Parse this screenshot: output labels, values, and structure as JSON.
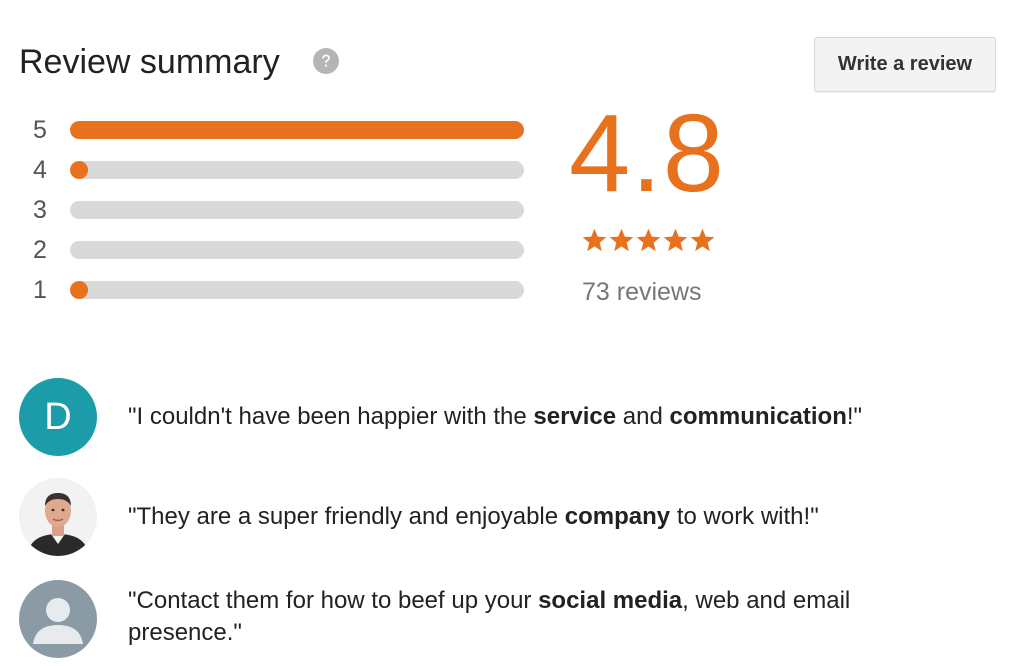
{
  "header": {
    "title": "Review summary",
    "help_icon": "question-circle-icon",
    "write_review_label": "Write a review"
  },
  "ratings": [
    {
      "label": "5",
      "fraction": 1.0
    },
    {
      "label": "4",
      "fraction": 0.04
    },
    {
      "label": "3",
      "fraction": 0.0
    },
    {
      "label": "2",
      "fraction": 0.0
    },
    {
      "label": "1",
      "fraction": 0.04
    }
  ],
  "summary": {
    "score": "4.8",
    "stars": 5,
    "review_count": "73 reviews"
  },
  "colors": {
    "accent": "#e8711e",
    "track": "#d9d9d9",
    "avatar_teal": "#1c9ca8",
    "avatar_gray": "#8a9ba6"
  },
  "reviews": [
    {
      "avatar": "letter-avatar",
      "avatar_letter": "D",
      "parts": [
        {
          "text": "\"I couldn't have been happier with the ",
          "bold": false
        },
        {
          "text": "service",
          "bold": true
        },
        {
          "text": " and ",
          "bold": false
        },
        {
          "text": "communication",
          "bold": true
        },
        {
          "text": "!\"",
          "bold": false
        }
      ]
    },
    {
      "avatar": "photo-avatar",
      "parts": [
        {
          "text": "\"They are a super friendly and enjoyable ",
          "bold": false
        },
        {
          "text": "company",
          "bold": true
        },
        {
          "text": " to work with!\"",
          "bold": false
        }
      ]
    },
    {
      "avatar": "default-user-avatar",
      "parts": [
        {
          "text": "\"Contact them for how to beef up your ",
          "bold": false
        },
        {
          "text": "social media",
          "bold": true
        },
        {
          "text": ", web and email presence.\"",
          "bold": false
        }
      ]
    }
  ]
}
